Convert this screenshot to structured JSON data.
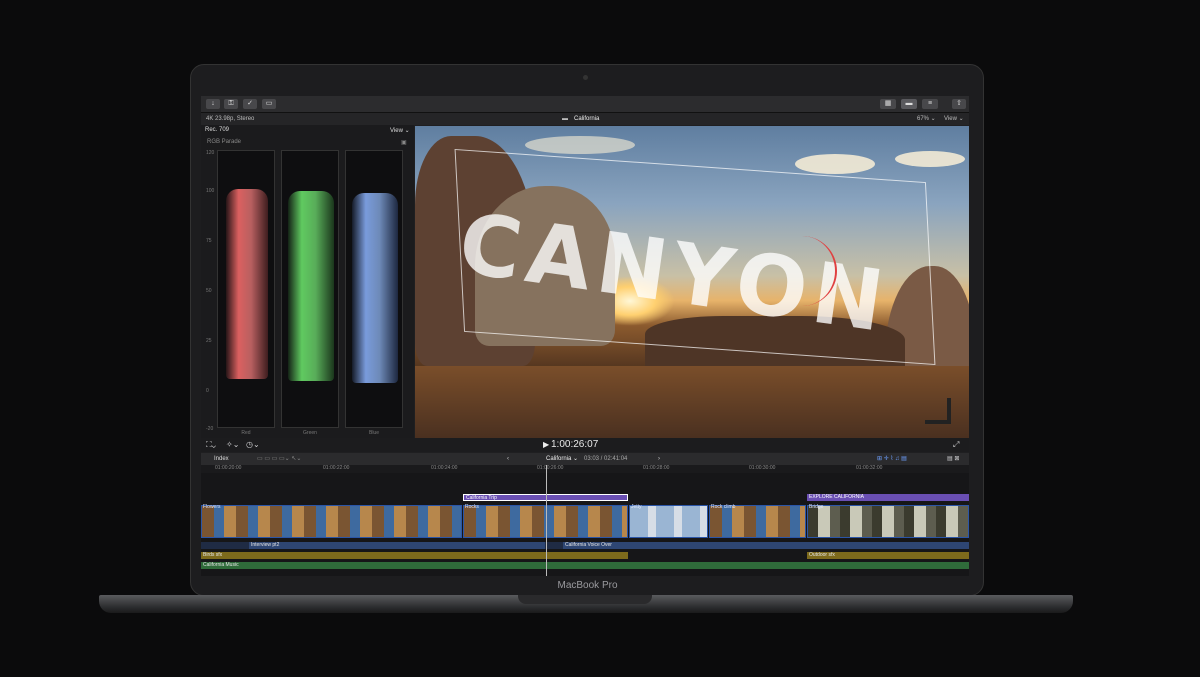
{
  "device": {
    "brand": "MacBook Pro"
  },
  "toolbar": {
    "left_icons": [
      "import-icon",
      "key-icon",
      "check-icon",
      "tag-icon"
    ],
    "right_icons": [
      "library-icon",
      "timeline-icon",
      "inspector-icon",
      "share-icon"
    ]
  },
  "infobar": {
    "format": "4K 23.98p, Stereo",
    "project": "California",
    "zoom": "67%",
    "zoom_menu": "View",
    "view_menu": "View"
  },
  "scope": {
    "standard": "Rec. 709",
    "name": "RGB Parade",
    "scale": [
      "120",
      "100",
      "75",
      "50",
      "25",
      "0",
      "-20"
    ],
    "channels": [
      {
        "label": "Red",
        "color": "#ff5a5a"
      },
      {
        "label": "Green",
        "color": "#4cd94c"
      },
      {
        "label": "Blue",
        "color": "#5a8dff"
      }
    ]
  },
  "viewer": {
    "overlay_title": "CANYON"
  },
  "playback": {
    "timecode": "1:00:26:07"
  },
  "timeline_nav": {
    "index_label": "Index",
    "project": "California",
    "position": "03:03 / 02:41:04"
  },
  "ruler": [
    "01:00:20:00",
    "01:00:22:00",
    "01:00:24:00",
    "01:00:26:00",
    "01:00:28:00",
    "01:00:30:00",
    "01:00:32:00"
  ],
  "timeline": {
    "titles": [
      {
        "label": "California Trip",
        "color": "#6a4fb3"
      },
      {
        "label": "EXPLORE CALIFORNIA",
        "color": "#6a4fb3"
      }
    ],
    "clips": [
      {
        "label": "Flowers"
      },
      {
        "label": "Rocks"
      },
      {
        "label": "Jetty"
      },
      {
        "label": "Rock climb"
      },
      {
        "label": "Bridge"
      }
    ],
    "audio": [
      {
        "label": "Interview pt2",
        "color": "#2e4673"
      },
      {
        "label": "California Voice Over",
        "color": "#2e4673"
      },
      {
        "label": "Birds sfx",
        "color": "#7d6a1c"
      },
      {
        "label": "Outdoor sfx",
        "color": "#7d6a1c"
      },
      {
        "label": "California Music",
        "color": "#2f6b3a"
      }
    ]
  }
}
